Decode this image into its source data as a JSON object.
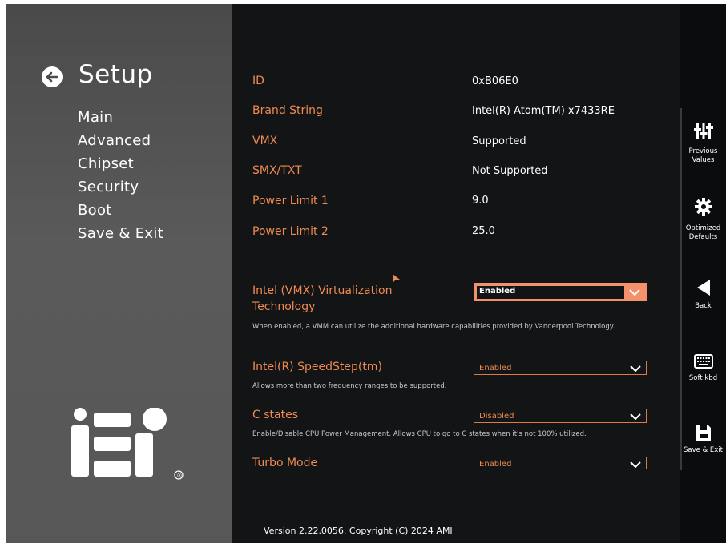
{
  "setup_title": "Setup",
  "nav": [
    "Main",
    "Advanced",
    "Chipset",
    "Security",
    "Boot",
    "Save & Exit"
  ],
  "logo": {
    "text": "iEi",
    "mark": "®"
  },
  "info": [
    {
      "label": "ID",
      "value": "0xB06E0"
    },
    {
      "label": "Brand String",
      "value": "Intel(R) Atom(TM) x7433RE"
    },
    {
      "label": "VMX",
      "value": "Supported"
    },
    {
      "label": "SMX/TXT",
      "value": "Not Supported"
    },
    {
      "label": "Power Limit 1",
      "value": "9.0"
    },
    {
      "label": "Power Limit 2",
      "value": "25.0"
    }
  ],
  "options": [
    {
      "label": "Intel (VMX) Virtualization Technology",
      "value": "Enabled",
      "help": "When enabled, a VMM can utilize the additional hardware capabilities provided by Vanderpool Technology."
    },
    {
      "label": "Intel(R) SpeedStep(tm)",
      "value": "Enabled",
      "help": "Allows more than two frequency ranges to be supported."
    },
    {
      "label": "C states",
      "value": "Disabled",
      "help": "Enable/Disable CPU Power Management. Allows CPU to go to C states when it's not 100% utilized."
    },
    {
      "label": "Turbo Mode",
      "value": "Enabled",
      "help": ""
    }
  ],
  "version": "Version 2.22.0056. Copyright (C) 2024 AMI",
  "side_buttons": [
    {
      "icon": "sliders-icon",
      "label": "Previous\nValues"
    },
    {
      "icon": "gear-icon",
      "label": "Optimized\nDefaults"
    },
    {
      "icon": "back-triangle-icon",
      "label": "Back"
    },
    {
      "icon": "keyboard-icon",
      "label": "Soft kbd"
    },
    {
      "icon": "floppy-disk-icon",
      "label": "Save & Exit"
    }
  ],
  "colors": {
    "accent": "#f08a52",
    "active_select": "#f4916a",
    "background": "#121416",
    "left_panel": "#555555"
  }
}
